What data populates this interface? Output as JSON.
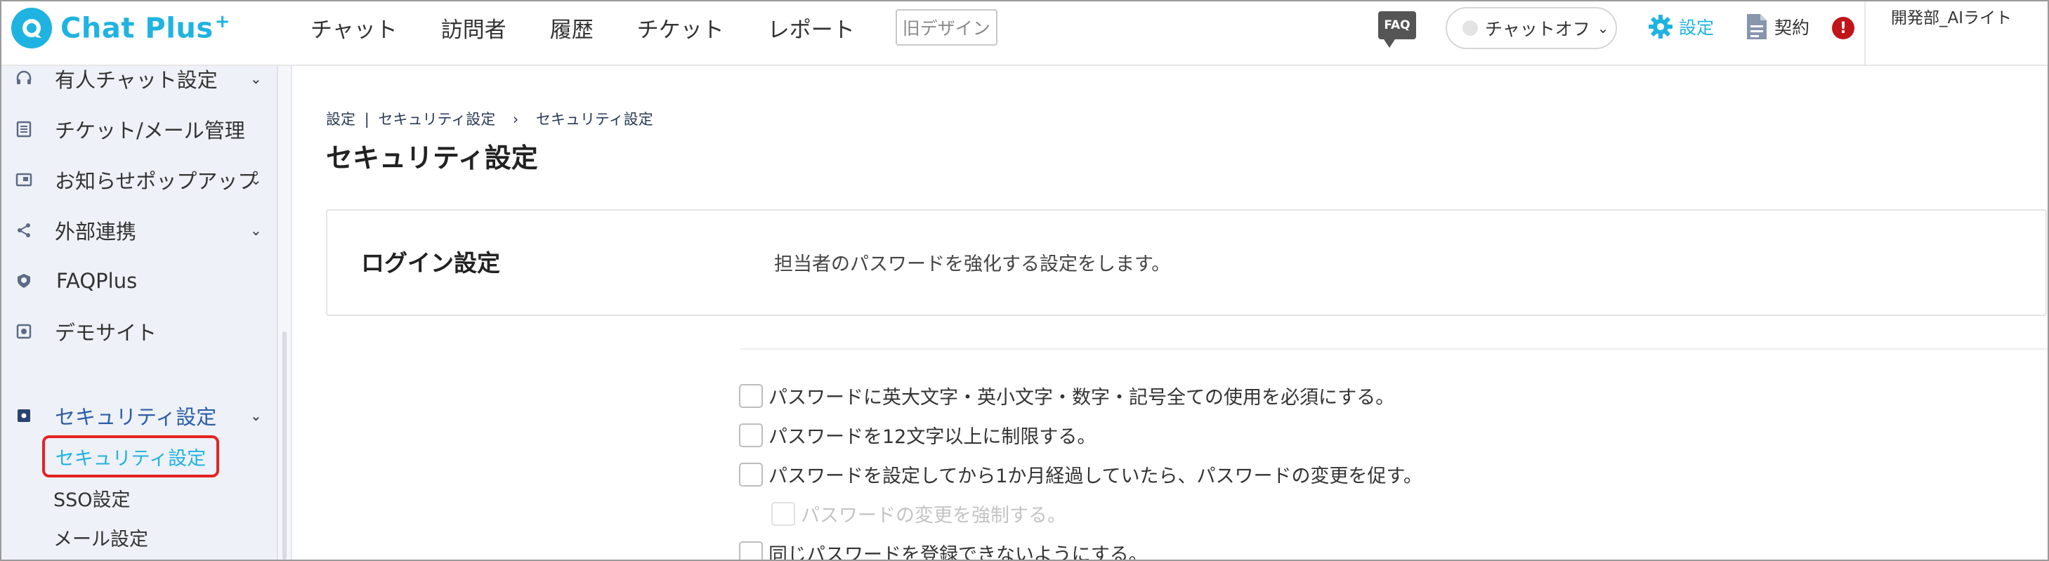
{
  "app": {
    "logo_text": "Chat Plus",
    "logo_plus": "+"
  },
  "header": {
    "nav": [
      "チャット",
      "訪問者",
      "履歴",
      "チケット",
      "レポート"
    ],
    "old_design": "旧デザイン",
    "faq_badge": "FAQ",
    "chat_status": "チャットオフ",
    "settings": "設定",
    "contract": "契約",
    "alert": "!",
    "user_name": "開発部_AIライト"
  },
  "sidebar": {
    "items": [
      {
        "label": "有人チャット設定",
        "icon": "headset-icon",
        "chevron": "⌄"
      },
      {
        "label": "チケット/メール管理",
        "icon": "ticket-icon",
        "chevron": ""
      },
      {
        "label": "お知らせポップアップ",
        "icon": "popup-icon",
        "chevron": "⌄"
      },
      {
        "label": "外部連携",
        "icon": "share-icon",
        "chevron": "⌄"
      },
      {
        "label": "FAQPlus",
        "icon": "faqplus-icon",
        "chevron": ""
      },
      {
        "label": "デモサイト",
        "icon": "demo-site-icon",
        "chevron": ""
      },
      {
        "label": "セキュリティ設定",
        "icon": "security-icon",
        "chevron": "⌄"
      }
    ],
    "sub_items": [
      "セキュリティ設定",
      "SSO設定",
      "メール設定"
    ]
  },
  "main": {
    "breadcrumb": {
      "root": "設定",
      "sep": "|",
      "parent": "セキュリティ設定",
      "arrow": "›",
      "current": "セキュリティ設定"
    },
    "title": "セキュリティ設定",
    "card": {
      "title": "ログイン設定",
      "description": "担当者のパスワードを強化する設定をします。"
    },
    "options": [
      {
        "label": "パスワードに英大文字・英小文字・数字・記号全ての使用を必須にする。",
        "checked": false,
        "disabled": false
      },
      {
        "label": "パスワードを12文字以上に制限する。",
        "checked": false,
        "disabled": false
      },
      {
        "label": "パスワードを設定してから1か月経過していたら、パスワードの変更を促す。",
        "checked": false,
        "disabled": false
      },
      {
        "label": "パスワードの変更を強制する。",
        "checked": false,
        "disabled": true
      },
      {
        "label": "同じパスワードを登録できないようにする。",
        "checked": false,
        "disabled": false
      }
    ]
  },
  "colors": {
    "brand": "#1fb3e1",
    "highlight_border": "#e32323",
    "alert": "#c0161a"
  }
}
